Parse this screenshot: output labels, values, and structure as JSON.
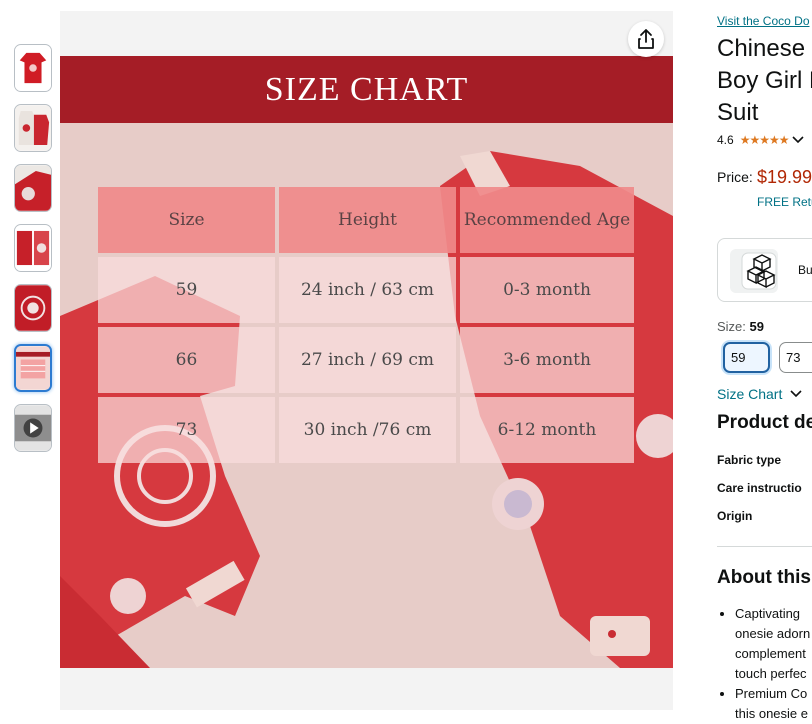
{
  "thumbnails": [
    {
      "name": "thumb-red-romper"
    },
    {
      "name": "thumb-white-red-set"
    },
    {
      "name": "thumb-closeup"
    },
    {
      "name": "thumb-detail"
    },
    {
      "name": "thumb-pattern"
    },
    {
      "name": "thumb-size-chart"
    },
    {
      "name": "thumb-video"
    }
  ],
  "main_image": {
    "banner": "SIZE CHART",
    "headers": [
      "Size",
      "Height",
      "Recommended Age"
    ],
    "rows": [
      [
        "59",
        "24 inch / 63 cm",
        "0-3 month"
      ],
      [
        "66",
        "27 inch / 69 cm",
        "3-6 month"
      ],
      [
        "73",
        "30 inch /76 cm",
        "6-12 month"
      ]
    ]
  },
  "product": {
    "visit_link": "Visit the Coco Do",
    "title_lines": [
      "Chinese N",
      "Boy Girl N",
      "Suit"
    ],
    "rating": "4.6",
    "stars": "★★★★★",
    "price_label": "Price:",
    "price": "$19.99",
    "free_returns": "FREE Retu",
    "bundle_text": "Bu",
    "size_label": "Size:",
    "size_selected": "59",
    "size_options": [
      "59",
      "73"
    ],
    "size_chart_link": "Size Chart",
    "details_heading": "Product de",
    "details": [
      "Fabric type",
      "Care instructio",
      "Origin"
    ],
    "about_heading": "About this",
    "bullets": [
      [
        "Captivating",
        "onesie adorn",
        "complement",
        "touch perfec"
      ],
      [
        "Premium Co",
        "this onesie e"
      ]
    ]
  },
  "colors": {
    "link": "#007185",
    "price": "#b12704",
    "banner": "#a51d26",
    "star": "#de7921"
  }
}
